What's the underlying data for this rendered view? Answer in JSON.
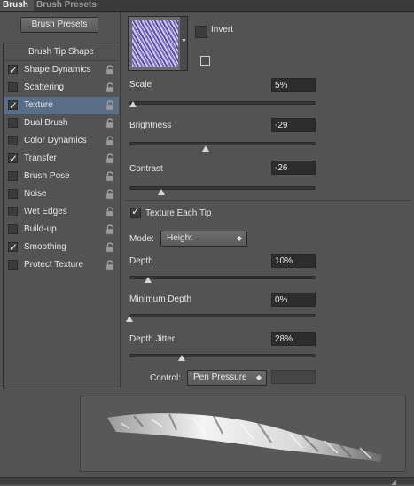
{
  "tabs": {
    "active": "Brush",
    "inactive": "Brush Presets"
  },
  "left": {
    "presets_button": "Brush Presets",
    "list_header": "Brush Tip Shape",
    "items": [
      {
        "label": "Shape Dynamics",
        "checked": true,
        "selected": false
      },
      {
        "label": "Scattering",
        "checked": false,
        "selected": false
      },
      {
        "label": "Texture",
        "checked": true,
        "selected": true
      },
      {
        "label": "Dual Brush",
        "checked": false,
        "selected": false
      },
      {
        "label": "Color Dynamics",
        "checked": false,
        "selected": false
      },
      {
        "label": "Transfer",
        "checked": true,
        "selected": false
      },
      {
        "label": "Brush Pose",
        "checked": false,
        "selected": false
      },
      {
        "label": "Noise",
        "checked": false,
        "selected": false
      },
      {
        "label": "Wet Edges",
        "checked": false,
        "selected": false
      },
      {
        "label": "Build-up",
        "checked": false,
        "selected": false
      },
      {
        "label": "Smoothing",
        "checked": true,
        "selected": false
      },
      {
        "label": "Protect Texture",
        "checked": false,
        "selected": false
      }
    ]
  },
  "texture": {
    "invert_label": "Invert",
    "invert_checked": false,
    "scale": {
      "label": "Scale",
      "value": "5%",
      "level": 0.02
    },
    "brightness": {
      "label": "Brightness",
      "value": "-29",
      "level": 0.41
    },
    "contrast": {
      "label": "Contrast",
      "value": "-26",
      "level": 0.17
    },
    "texture_each_tip_label": "Texture Each Tip",
    "texture_each_tip_checked": true,
    "mode_label": "Mode:",
    "mode_value": "Height",
    "depth": {
      "label": "Depth",
      "value": "10%",
      "level": 0.1
    },
    "min_depth": {
      "label": "Minimum Depth",
      "value": "0%",
      "level": 0.0
    },
    "depth_jitter": {
      "label": "Depth Jitter",
      "value": "28%",
      "level": 0.28
    },
    "control_label": "Control:",
    "control_value": "Pen Pressure"
  },
  "colors": {
    "panel_bg": "#535353",
    "selected_item": "#596f87",
    "field_bg": "#2d2d2d"
  }
}
